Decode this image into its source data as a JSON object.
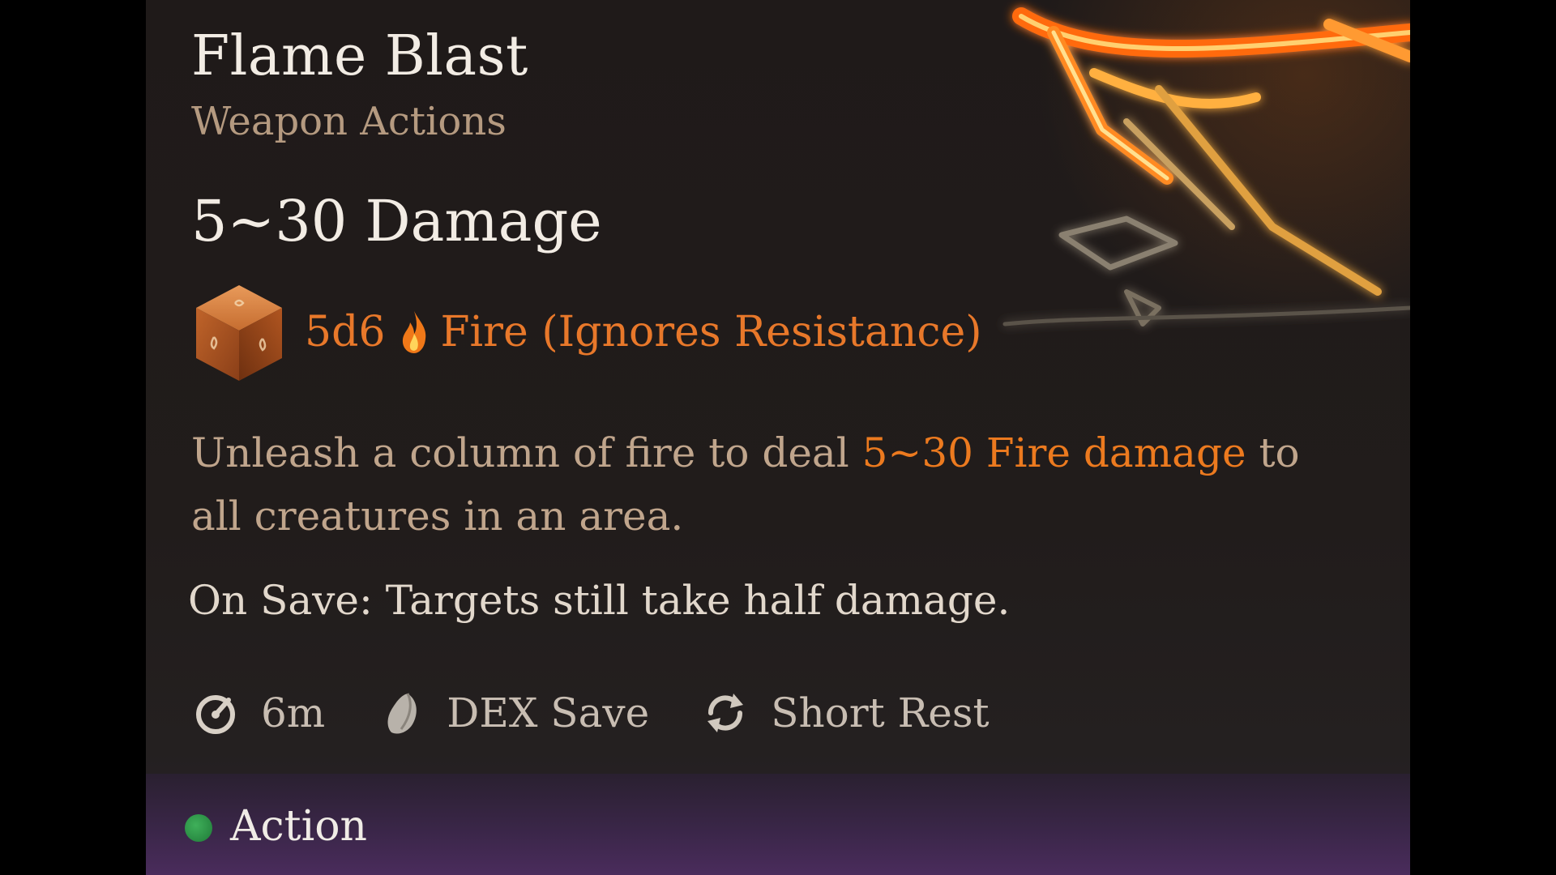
{
  "spell": {
    "title": "Flame Blast",
    "subtitle": "Weapon Actions",
    "damage_heading": "5~30 Damage",
    "dice": "5d6",
    "damage_type": "Fire (Ignores Resistance)",
    "description_pre": "Unleash a column of fire to deal ",
    "description_highlight": "5~30 Fire damage",
    "description_post": " to all creatures in an area.",
    "on_save": "On Save: Targets still take half damage."
  },
  "stats": {
    "range": "6m",
    "save": "DEX Save",
    "recharge": "Short Rest"
  },
  "footer": {
    "cost_label": "Action"
  },
  "colors": {
    "highlight": "#ec7a1f",
    "title": "#f2ece4",
    "subtitle": "#b59a80",
    "action_dot": "#2e9a4c"
  },
  "icons": {
    "dice": "d6-die-icon",
    "damage_type": "fire-icon",
    "range": "range-icon",
    "save": "saving-throw-icon",
    "recharge": "short-rest-icon",
    "cost": "action-dot-icon"
  }
}
